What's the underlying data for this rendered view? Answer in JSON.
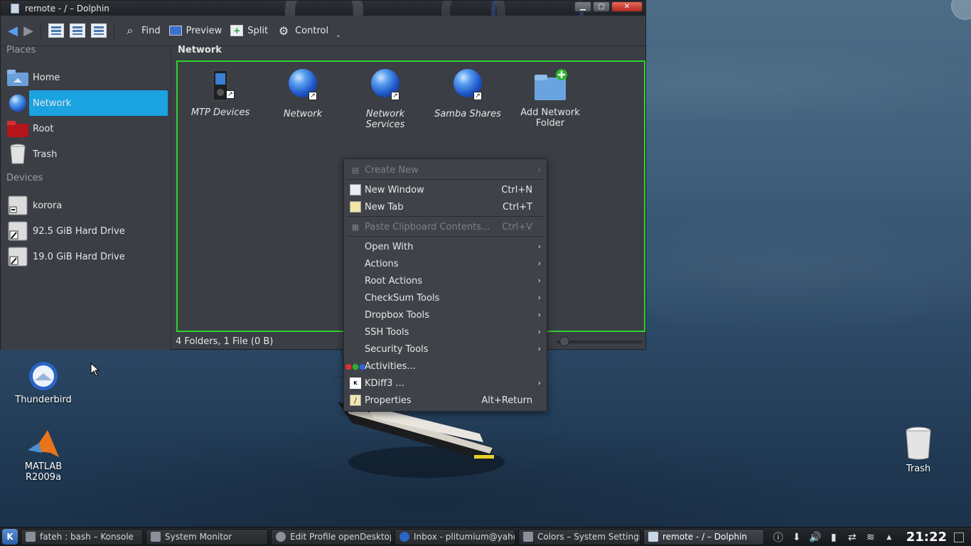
{
  "window": {
    "title": "remote - / – Dolphin",
    "controls": [
      "minimize",
      "maximize",
      "close"
    ]
  },
  "toolbar": {
    "back_icon": "back-arrow-icon",
    "forward_icon": "forward-arrow-icon",
    "find_label": "Find",
    "preview_label": "Preview",
    "split_label": "Split",
    "control_label": "Control"
  },
  "places": {
    "title": "Places",
    "items": [
      {
        "label": "Home",
        "icon": "home-folder-icon"
      },
      {
        "label": "Network",
        "icon": "network-globe-icon",
        "active": true
      },
      {
        "label": "Root",
        "icon": "root-folder-icon"
      },
      {
        "label": "Trash",
        "icon": "trash-icon"
      }
    ]
  },
  "devices": {
    "title": "Devices",
    "items": [
      {
        "label": "korora",
        "icon": "drive-icon"
      },
      {
        "label": "92.5 GiB Hard Drive",
        "icon": "hard-drive-icon"
      },
      {
        "label": "19.0 GiB Hard Drive",
        "icon": "hard-drive-icon"
      }
    ]
  },
  "main": {
    "breadcrumb": "Network",
    "files": [
      {
        "label": "MTP Devices",
        "icon": "mtp-device-icon"
      },
      {
        "label": "Network",
        "icon": "network-globe-icon"
      },
      {
        "label": "Network Services",
        "icon": "network-globe-icon"
      },
      {
        "label": "Samba Shares",
        "icon": "network-globe-icon"
      },
      {
        "label": "Add Network Folder",
        "icon": "add-network-folder-icon"
      }
    ],
    "status": "4 Folders, 1 File (0 B)"
  },
  "context_menu": {
    "items": [
      {
        "label": "Create New",
        "disabled": true,
        "submenu": true
      },
      {
        "label": "New Window",
        "shortcut": "Ctrl+N"
      },
      {
        "label": "New Tab",
        "shortcut": "Ctrl+T"
      },
      {
        "label": "Paste Clipboard Contents...",
        "shortcut": "Ctrl+V",
        "disabled": true
      },
      {
        "label": "Open With",
        "submenu": true
      },
      {
        "label": "Actions",
        "submenu": true
      },
      {
        "label": "Root Actions",
        "submenu": true
      },
      {
        "label": "CheckSum Tools",
        "submenu": true
      },
      {
        "label": "Dropbox Tools",
        "submenu": true
      },
      {
        "label": "SSH Tools",
        "submenu": true
      },
      {
        "label": "Security Tools",
        "submenu": true
      },
      {
        "label": "Activities..."
      },
      {
        "label": "KDiff3 ...",
        "submenu": true
      },
      {
        "label": "Properties",
        "shortcut": "Alt+Return"
      }
    ]
  },
  "desktop": {
    "icons": [
      {
        "label": "Thunderbird",
        "icon": "thunderbird-icon"
      },
      {
        "label": "MATLAB\nR2009a",
        "icon": "matlab-icon"
      },
      {
        "label": "Trash",
        "icon": "trash-icon"
      }
    ]
  },
  "taskbar": {
    "tasks": [
      {
        "label": "fateh : bash – Konsole"
      },
      {
        "label": "System Monitor"
      },
      {
        "label": "Edit Profile openDesktop.o"
      },
      {
        "label": "Inbox - plitumium@yahoo"
      },
      {
        "label": "Colors – System Settings"
      },
      {
        "label": "remote - / – Dolphin",
        "active": true
      }
    ],
    "clock": "21:22"
  },
  "colors": {
    "accent": "#1aa3e0",
    "focus_border": "#2ed12e",
    "window_bg": "#3b3e44"
  }
}
